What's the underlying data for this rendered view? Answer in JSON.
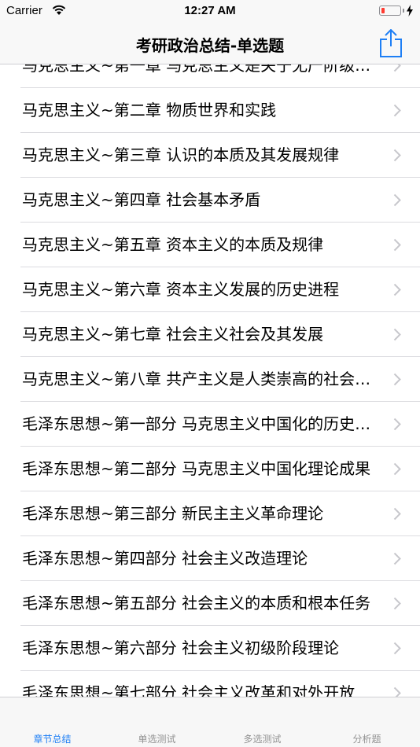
{
  "status_bar": {
    "carrier": "Carrier",
    "time": "12:27 AM",
    "battery_color": "#ff3b30"
  },
  "nav": {
    "title": "考研政治总结-单选题",
    "share_icon": "share-icon",
    "accent_color": "#1e7ff5"
  },
  "list": {
    "items": [
      {
        "label": "马克思主义~第一章 马克思主义是关于无产阶级和人类解放的科学"
      },
      {
        "label": "马克思主义~第二章 物质世界和实践"
      },
      {
        "label": "马克思主义~第三章 认识的本质及其发展规律"
      },
      {
        "label": "马克思主义~第四章 社会基本矛盾"
      },
      {
        "label": "马克思主义~第五章 资本主义的本质及规律"
      },
      {
        "label": "马克思主义~第六章 资本主义发展的历史进程"
      },
      {
        "label": "马克思主义~第七章 社会主义社会及其发展"
      },
      {
        "label": "马克思主义~第八章 共产主义是人类崇高的社会理想"
      },
      {
        "label": "毛泽东思想~第一部分 马克思主义中国化的历史进程"
      },
      {
        "label": "毛泽东思想~第二部分 马克思主义中国化理论成果"
      },
      {
        "label": "毛泽东思想~第三部分 新民主主义革命理论"
      },
      {
        "label": "毛泽东思想~第四部分 社会主义改造理论"
      },
      {
        "label": "毛泽东思想~第五部分 社会主义的本质和根本任务"
      },
      {
        "label": "毛泽东思想~第六部分 社会主义初级阶段理论"
      },
      {
        "label": "毛泽东思想~第七部分 社会主义改革和对外开放"
      }
    ]
  },
  "tabs": [
    {
      "label": "章节总结",
      "active": true
    },
    {
      "label": "单选测试",
      "active": false
    },
    {
      "label": "多选测试",
      "active": false
    },
    {
      "label": "分析题",
      "active": false
    }
  ]
}
